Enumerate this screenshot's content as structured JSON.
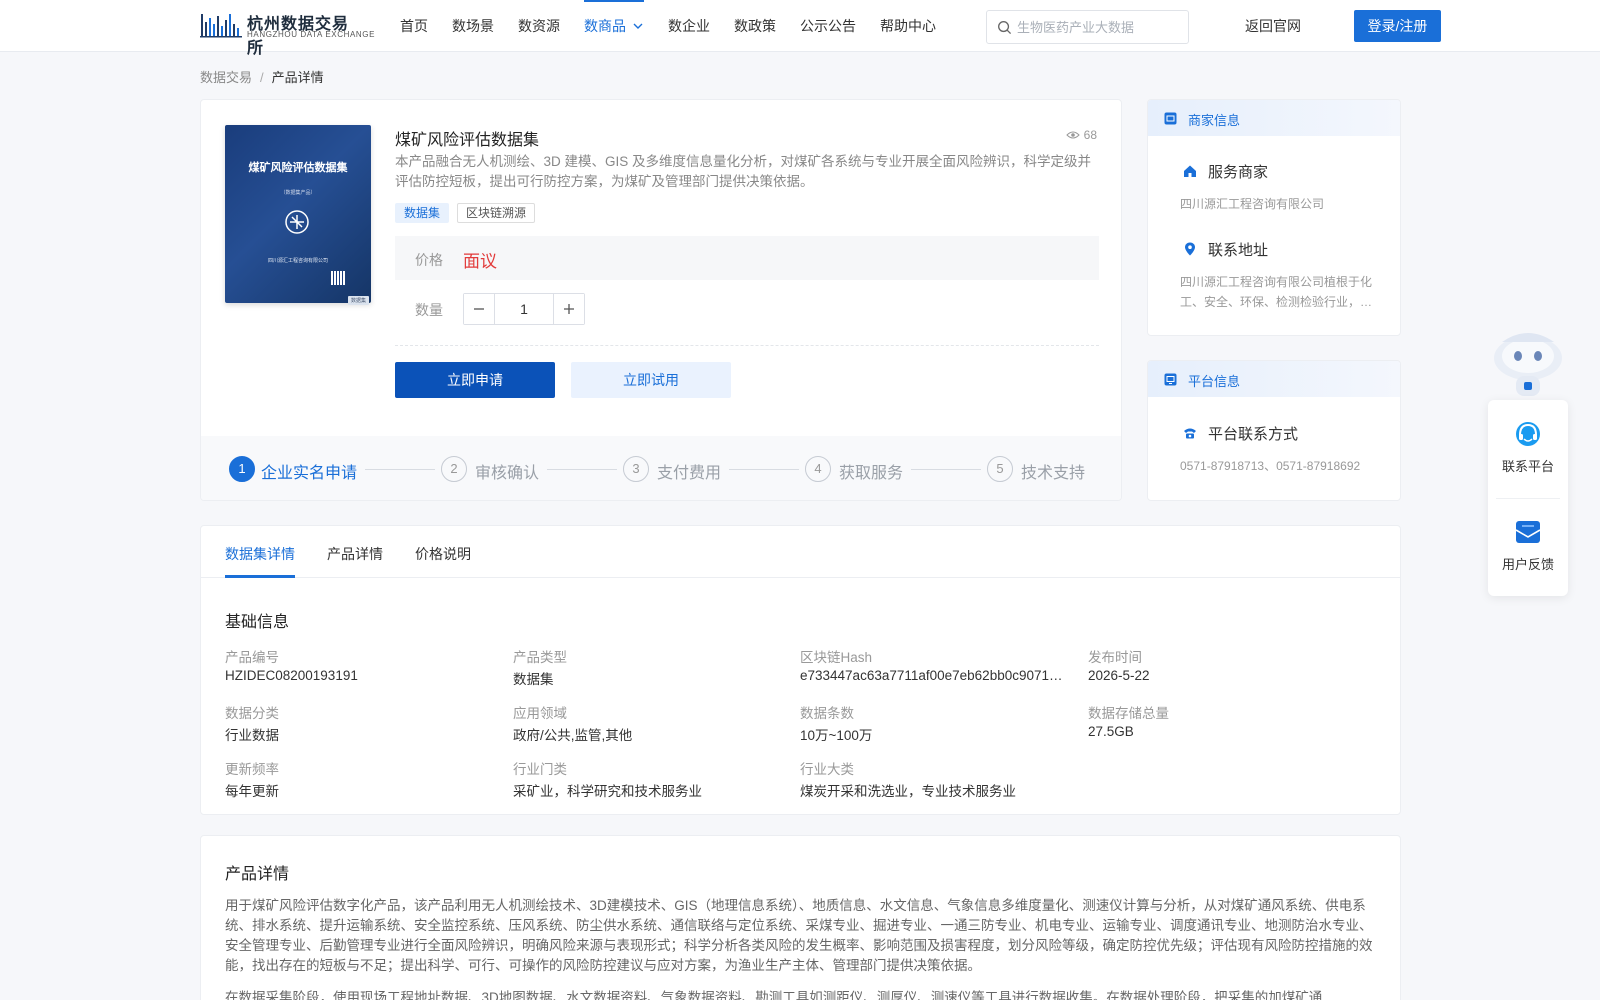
{
  "header": {
    "logo_title": "杭州数据交易所",
    "logo_sub": "HANGZHOU DATA EXCHANGE",
    "nav": [
      "首页",
      "数场景",
      "数资源",
      "数商品",
      "数企业",
      "数政策",
      "公示公告",
      "帮助中心"
    ],
    "active_nav": "数商品",
    "search_placeholder": "生物医药产业大数据",
    "back_link": "返回官网",
    "login_label": "登录/注册"
  },
  "breadcrumb": {
    "parent": "数据交易",
    "separator": "/",
    "current": "产品详情"
  },
  "product": {
    "cover_title": "煤矿风险评估数据集",
    "cover_sub": "（数据集产品）",
    "cover_footer": "四川源汇工程咨询有限公司",
    "cover_tag": "数据集",
    "title": "煤矿风险评估数据集",
    "views": "68",
    "description": "本产品融合无人机测绘、3D 建模、GIS 及多维度信息量化分析，对煤矿各系统与专业开展全面风险辨识，科学定级并评估防控短板，提出可行防控方案，为煤矿及管理部门提供决策依据。",
    "tags": [
      "数据集",
      "区块链溯源"
    ],
    "price_label": "价格",
    "price_value": "面议",
    "quantity_label": "数量",
    "quantity_value": "1",
    "apply_label": "立即申请",
    "trial_label": "立即试用"
  },
  "steps": [
    {
      "num": "1",
      "label": "企业实名申请"
    },
    {
      "num": "2",
      "label": "审核确认"
    },
    {
      "num": "3",
      "label": "支付费用"
    },
    {
      "num": "4",
      "label": "获取服务"
    },
    {
      "num": "5",
      "label": "技术支持"
    }
  ],
  "merchant": {
    "title": "商家信息",
    "service_label": "服务商家",
    "service_value": "四川源汇工程咨询有限公司",
    "address_label": "联系地址",
    "address_value": "四川源汇工程咨询有限公司植根于化工、安全、环保、检测检验行业，致力于为客户提供专业服务"
  },
  "platform": {
    "title": "平台信息",
    "contact_label": "平台联系方式",
    "contact_value": "0571-87918713、0571-87918692"
  },
  "float": {
    "contact": "联系平台",
    "feedback": "用户反馈"
  },
  "detail": {
    "tabs": [
      "数据集详情",
      "产品详情",
      "价格说明"
    ],
    "section_title": "基础信息",
    "fields": [
      {
        "label": "产品编号",
        "value": "HZIDEC08200193191"
      },
      {
        "label": "产品类型",
        "value": "数据集"
      },
      {
        "label": "区块链Hash",
        "value": "e733447ac63a7711af00e7eb62bb0c9071…"
      },
      {
        "label": "发布时间",
        "value": "2026-5-22"
      },
      {
        "label": "数据分类",
        "value": "行业数据"
      },
      {
        "label": "应用领域",
        "value": "政府/公共,监管,其他"
      },
      {
        "label": "数据条数",
        "value": "10万~100万"
      },
      {
        "label": "数据存储总量",
        "value": "27.5GB"
      },
      {
        "label": "更新频率",
        "value": "每年更新"
      },
      {
        "label": "行业门类",
        "value": "采矿业，科学研究和技术服务业"
      },
      {
        "label": "行业大类",
        "value": "煤炭开采和洗选业，专业技术服务业"
      }
    ]
  },
  "intro": {
    "title": "产品详情",
    "text": "用于煤矿风险评估数字化产品，该产品利用无人机测绘技术、3D建模技术、GIS（地理信息系统）、地质信息、水文信息、气象信息多维度量化、测速仪计算与分析，从对煤矿通风系统、供电系统、排水系统、提升运输系统、安全监控系统、压风系统、防尘供水系统、通信联络与定位系统、采煤专业、掘进专业、一通三防专业、机电专业、运输专业、调度通讯专业、地测防治水专业、安全管理专业、后勤管理专业进行全面风险辨识，明确风险来源与表现形式；科学分析各类风险的发生概率、影响范围及损害程度，划分风险等级，确定防控优先级；评估现有风险防控措施的效能，找出存在的短板与不足；提出科学、可行、可操作的风险防控建议与应对方案，为渔业生产主体、管理部门提供决策依据。",
    "text2": "在数据采集阶段，使用现场工程地址数据、3D地图数据、水文数据资料、气象数据资料、勘测工具如测距仪、测厚仪、测速仪等工具进行数据收集。在数据处理阶段，把采集的加煤矿通"
  }
}
